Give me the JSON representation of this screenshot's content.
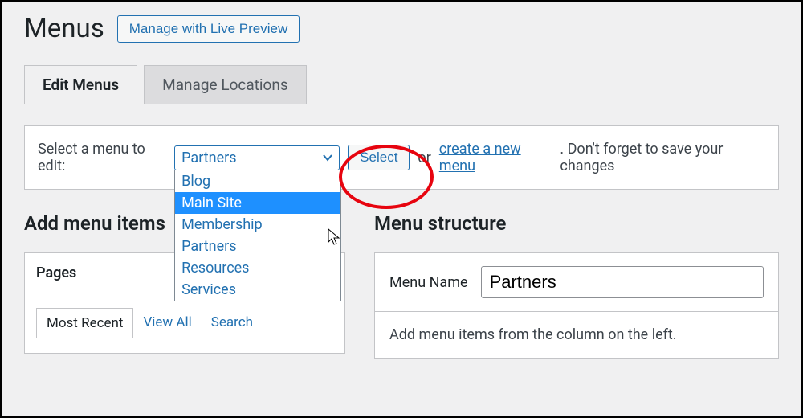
{
  "header": {
    "title": "Menus",
    "live_preview_label": "Manage with Live Preview"
  },
  "tabs": {
    "edit": "Edit Menus",
    "locations": "Manage Locations"
  },
  "selector": {
    "label": "Select a menu to edit:",
    "current": "Partners",
    "options": [
      "Blog",
      "Main Site",
      "Membership",
      "Partners",
      "Resources",
      "Services"
    ],
    "hovered_index": 1,
    "select_button": "Select",
    "or": "or",
    "create_link": "create a new menu",
    "tail_text": ". Don't forget to save your changes"
  },
  "left": {
    "section_title": "Add menu items",
    "metabox_title": "Pages",
    "subtabs": {
      "recent": "Most Recent",
      "all": "View All",
      "search": "Search"
    }
  },
  "right": {
    "section_title": "Menu structure",
    "menu_name_label": "Menu Name",
    "menu_name_value": "Partners",
    "instruction": "Add menu items from the column on the left."
  }
}
